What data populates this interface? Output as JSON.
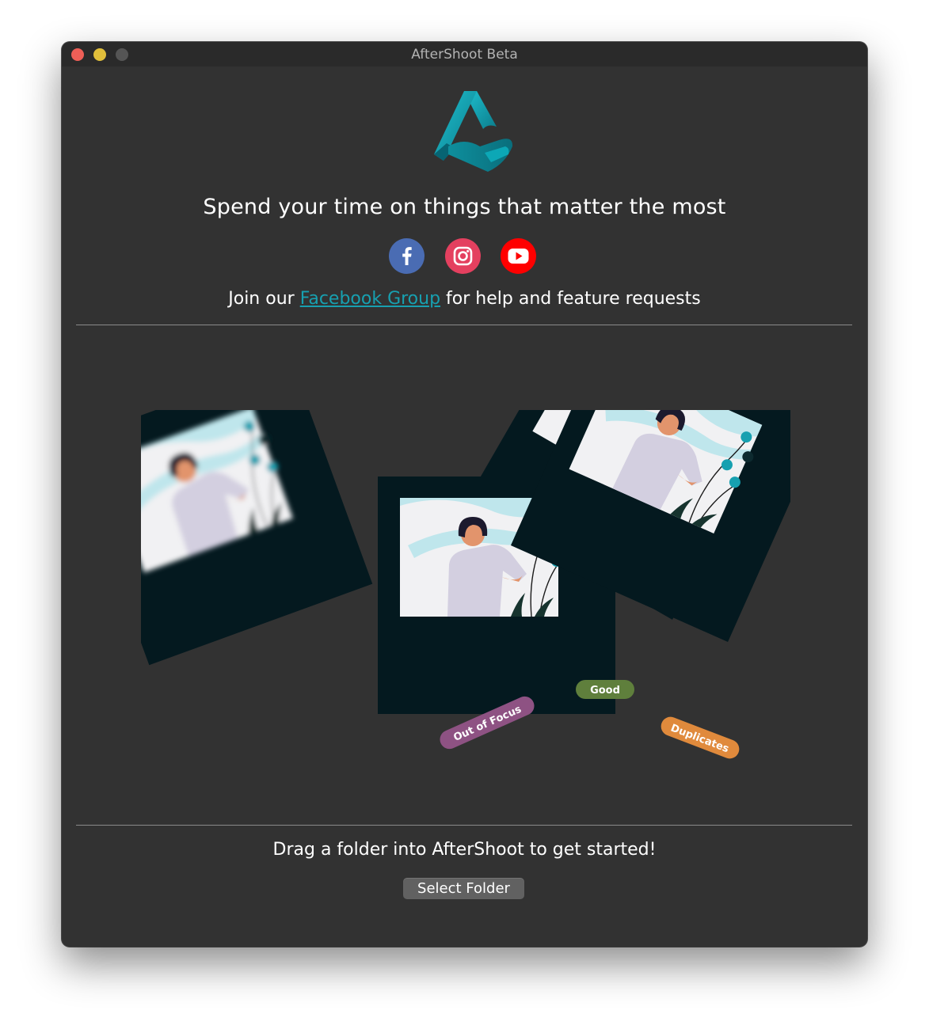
{
  "window": {
    "title": "AfterShoot Beta"
  },
  "header": {
    "tagline": "Spend your time on things that matter the most",
    "social": [
      {
        "name": "facebook",
        "icon": "facebook-icon",
        "color": "#4a6cb3"
      },
      {
        "name": "instagram",
        "icon": "instagram-icon",
        "color": "#e4405f"
      },
      {
        "name": "youtube",
        "icon": "youtube-icon",
        "color": "#ff0000"
      }
    ],
    "join_prefix": "Join our ",
    "join_link": "Facebook Group",
    "join_suffix": " for help and feature requests"
  },
  "illustration": {
    "labels": {
      "out_of_focus": "Out of Focus",
      "good": "Good",
      "duplicates": "Duplicates"
    },
    "label_colors": {
      "out_of_focus": "#8e5283",
      "good": "#5f7f3c",
      "duplicates": "#e08a3c"
    }
  },
  "footer": {
    "instruction": "Drag a folder into AfterShoot to get started!",
    "select_button": "Select Folder"
  },
  "colors": {
    "accent": "#17a0b0",
    "background": "#323232",
    "frame": "#04191f"
  }
}
